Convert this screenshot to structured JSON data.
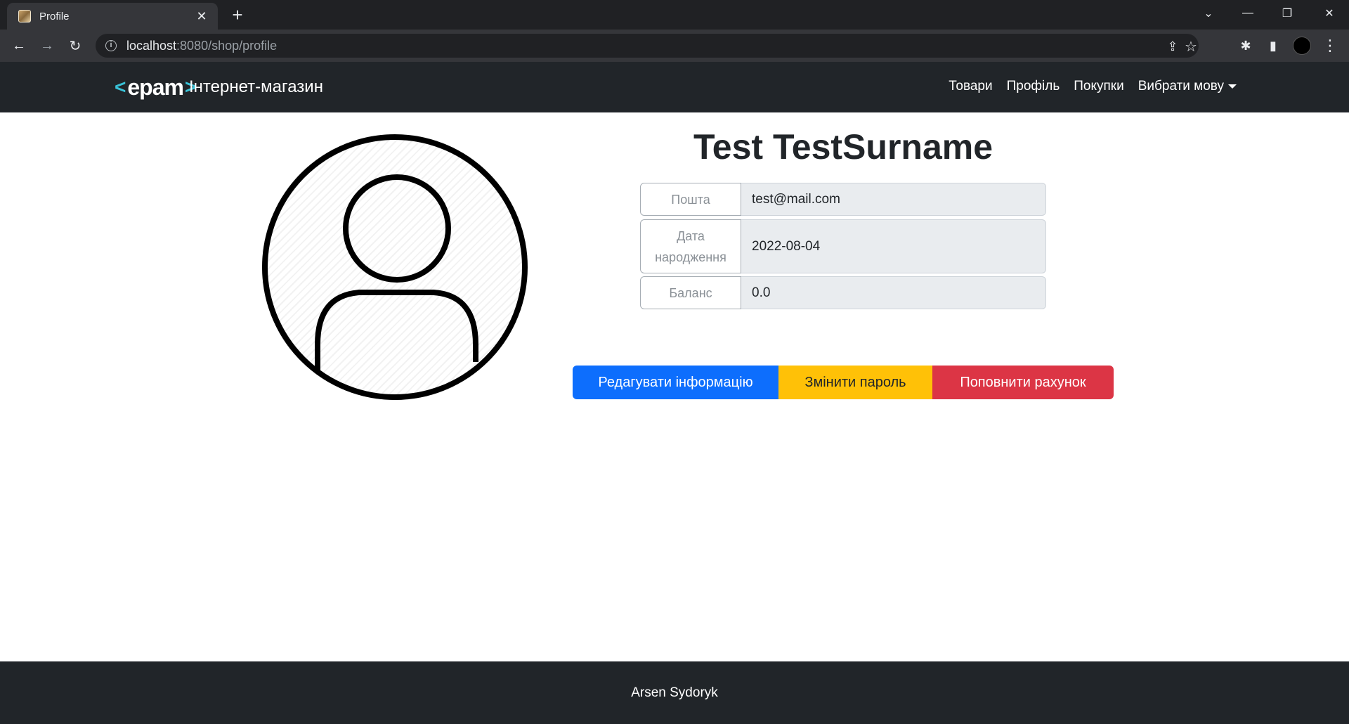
{
  "browser": {
    "tab_title": "Profile",
    "tab_close": "✕",
    "new_tab": "+",
    "url_host": "localhost",
    "url_path": ":8080/shop/profile",
    "win_dropdown": "⌄",
    "win_minimize": "—",
    "win_restore": "❐",
    "win_close": "✕",
    "back": "←",
    "forward": "→",
    "reload": "↻",
    "share_icon": "⇪",
    "star_icon": "☆",
    "extensions_icon": "✱",
    "sidepanel_icon": "▮",
    "menu_icon": "⋮"
  },
  "navbar": {
    "logo_left": "<",
    "logo_text": "epam",
    "logo_right": ">",
    "brand": "Інтернет-магазин",
    "links": [
      "Товари",
      "Профіль",
      "Покупки",
      "Вибрати мову"
    ]
  },
  "profile": {
    "name": "Test TestSurname",
    "fields": [
      {
        "label": "Пошта",
        "value": "test@mail.com"
      },
      {
        "label": "Дата народження",
        "value": "2022-08-04"
      },
      {
        "label": "Баланс",
        "value": "0.0"
      }
    ]
  },
  "actions": {
    "edit": "Редагувати інформацію",
    "change_password": "Змінити пароль",
    "top_up": "Поповнити рахунок"
  },
  "footer": {
    "author": "Arsen Sydoryk"
  }
}
